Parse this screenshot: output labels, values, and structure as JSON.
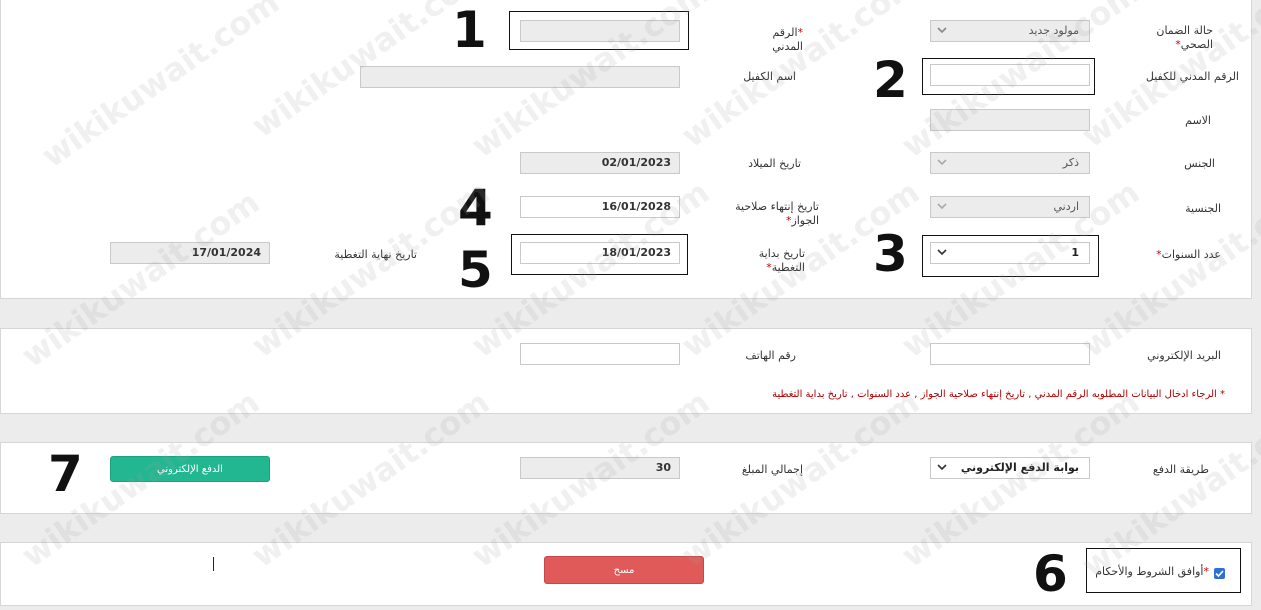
{
  "form": {
    "insurance_status_label": "حالة الضمان الصحي",
    "insurance_status_value": "مولود جديد",
    "civil_id_label": "الرقم المدني",
    "sponsor_civil_id_label": "الرقم المدني للكفيل",
    "sponsor_name_label": "اسم الكفيل",
    "name_label": "الاسم",
    "gender_label": "الجنس",
    "gender_value": "ذكر",
    "birthdate_label": "تاريخ الميلاد",
    "birthdate_value": "02/01/2023",
    "nationality_label": "الجنسية",
    "nationality_value": "اردني",
    "passport_expiry_label": "تاريخ إنتهاء صلاحية الجواز",
    "passport_expiry_value": "16/01/2028",
    "years_label": "عدد السنوات",
    "years_value": "1",
    "coverage_start_label": "تاريخ بداية التغطية",
    "coverage_start_value": "18/01/2023",
    "coverage_end_label": "تاريخ نهاية التغطية",
    "coverage_end_value": "17/01/2024",
    "required_mark": "*"
  },
  "contact": {
    "email_label": "البريد الإلكتروني",
    "phone_label": "رقم الهاتف",
    "warning": "* الرجاء ادخال البيانات المطلوبه الرقم المدني , تاريخ إنتهاء صلاحية الجواز , عدد السنوات , تاريخ بداية التغطية"
  },
  "payment": {
    "method_label": "طريقة الدفع",
    "method_value": "بوابة الدفع الإلكتروني",
    "total_label": "إجمالي المبلغ",
    "total_value": "30",
    "pay_button": "الدفع الإلكتروني"
  },
  "footer": {
    "terms_label": "أوافق الشروط والأحكام",
    "clear_button": "مسح"
  },
  "annotations": [
    "1",
    "2",
    "3",
    "4",
    "5",
    "6",
    "7"
  ],
  "watermark": "wikikuwait.com",
  "colors": {
    "pay": "#22b791",
    "clear": "#e05a5a",
    "required": "#c00000"
  }
}
